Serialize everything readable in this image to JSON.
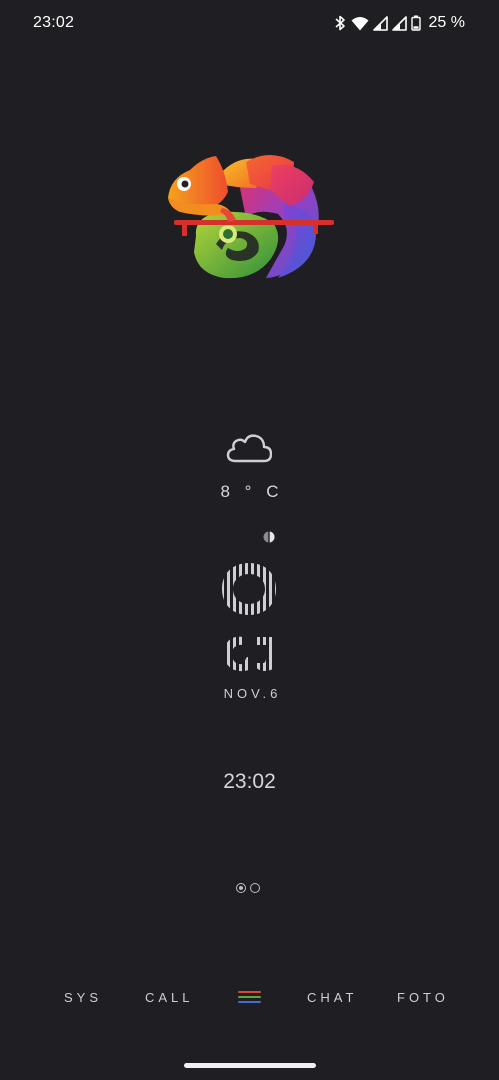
{
  "status_bar": {
    "time": "23:02",
    "battery_percent": "25 %",
    "icons": [
      "bluetooth-icon",
      "wifi-icon",
      "signal-icon",
      "signal-icon",
      "battery-icon"
    ]
  },
  "widget": {
    "weather_icon": "cloud-icon",
    "temperature": "8 ° C",
    "date": "NOV.6",
    "clock": "23:02",
    "big_digits": [
      "0",
      "5"
    ]
  },
  "pager": {
    "pages": 2,
    "active_index": 0
  },
  "dock": {
    "sys": "SYS",
    "call": "CALL",
    "chat": "CHAT",
    "foto": "FOTO",
    "menu_icon": "menu-icon",
    "menu_colors": [
      "#e0453a",
      "#5aa83c",
      "#3b6fd4"
    ]
  },
  "colors": {
    "background": "#1f1e23",
    "text": "#d6d6d9"
  }
}
